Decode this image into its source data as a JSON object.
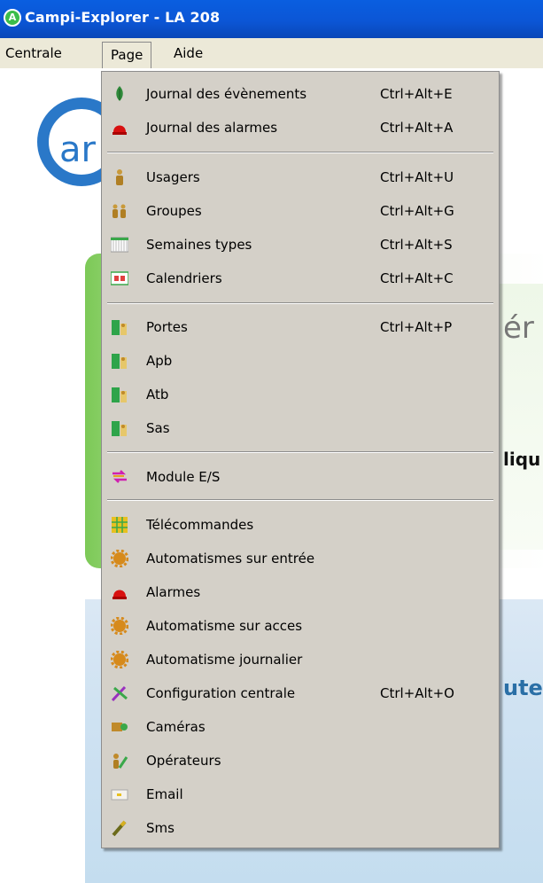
{
  "window": {
    "title": "Campi-Explorer - LA 208",
    "app_icon_letter": "A"
  },
  "menubar": {
    "items": [
      "Centrale",
      "Page",
      "Aide"
    ]
  },
  "background": {
    "logo_text": "ar",
    "peek1": "ér",
    "peek2": "liqu",
    "peek3": "ute"
  },
  "menu": {
    "items": [
      {
        "label": "Journal des évènements",
        "shortcut": "Ctrl+Alt+E",
        "icon": "leaf-icon"
      },
      {
        "label": "Journal des alarmes",
        "shortcut": "Ctrl+Alt+A",
        "icon": "alarm-icon"
      },
      {
        "label": "Usagers",
        "shortcut": "Ctrl+Alt+U",
        "icon": "user-icon"
      },
      {
        "label": "Groupes",
        "shortcut": "Ctrl+Alt+G",
        "icon": "group-icon"
      },
      {
        "label": "Semaines types",
        "shortcut": "Ctrl+Alt+S",
        "icon": "week-icon"
      },
      {
        "label": "Calendriers",
        "shortcut": "Ctrl+Alt+C",
        "icon": "calendar-icon"
      },
      {
        "label": "Portes",
        "shortcut": "Ctrl+Alt+P",
        "icon": "door-icon"
      },
      {
        "label": "Apb",
        "shortcut": "",
        "icon": "door-icon"
      },
      {
        "label": "Atb",
        "shortcut": "",
        "icon": "door-icon"
      },
      {
        "label": "Sas",
        "shortcut": "",
        "icon": "door-icon"
      },
      {
        "label": "Module E/S",
        "shortcut": "",
        "icon": "io-module-icon"
      },
      {
        "label": "Télécommandes",
        "shortcut": "",
        "icon": "remote-icon"
      },
      {
        "label": "Automatismes sur entrée",
        "shortcut": "",
        "icon": "gear-icon"
      },
      {
        "label": "Alarmes",
        "shortcut": "",
        "icon": "alarm-icon"
      },
      {
        "label": "Automatisme sur acces",
        "shortcut": "",
        "icon": "gear-icon"
      },
      {
        "label": "Automatisme journalier",
        "shortcut": "",
        "icon": "gear-icon"
      },
      {
        "label": "Configuration centrale",
        "shortcut": "Ctrl+Alt+O",
        "icon": "config-icon"
      },
      {
        "label": "Caméras",
        "shortcut": "",
        "icon": "camera-icon"
      },
      {
        "label": "Opérateurs",
        "shortcut": "",
        "icon": "operator-icon"
      },
      {
        "label": "Email",
        "shortcut": "",
        "icon": "email-icon"
      },
      {
        "label": "Sms",
        "shortcut": "",
        "icon": "sms-icon"
      }
    ]
  }
}
